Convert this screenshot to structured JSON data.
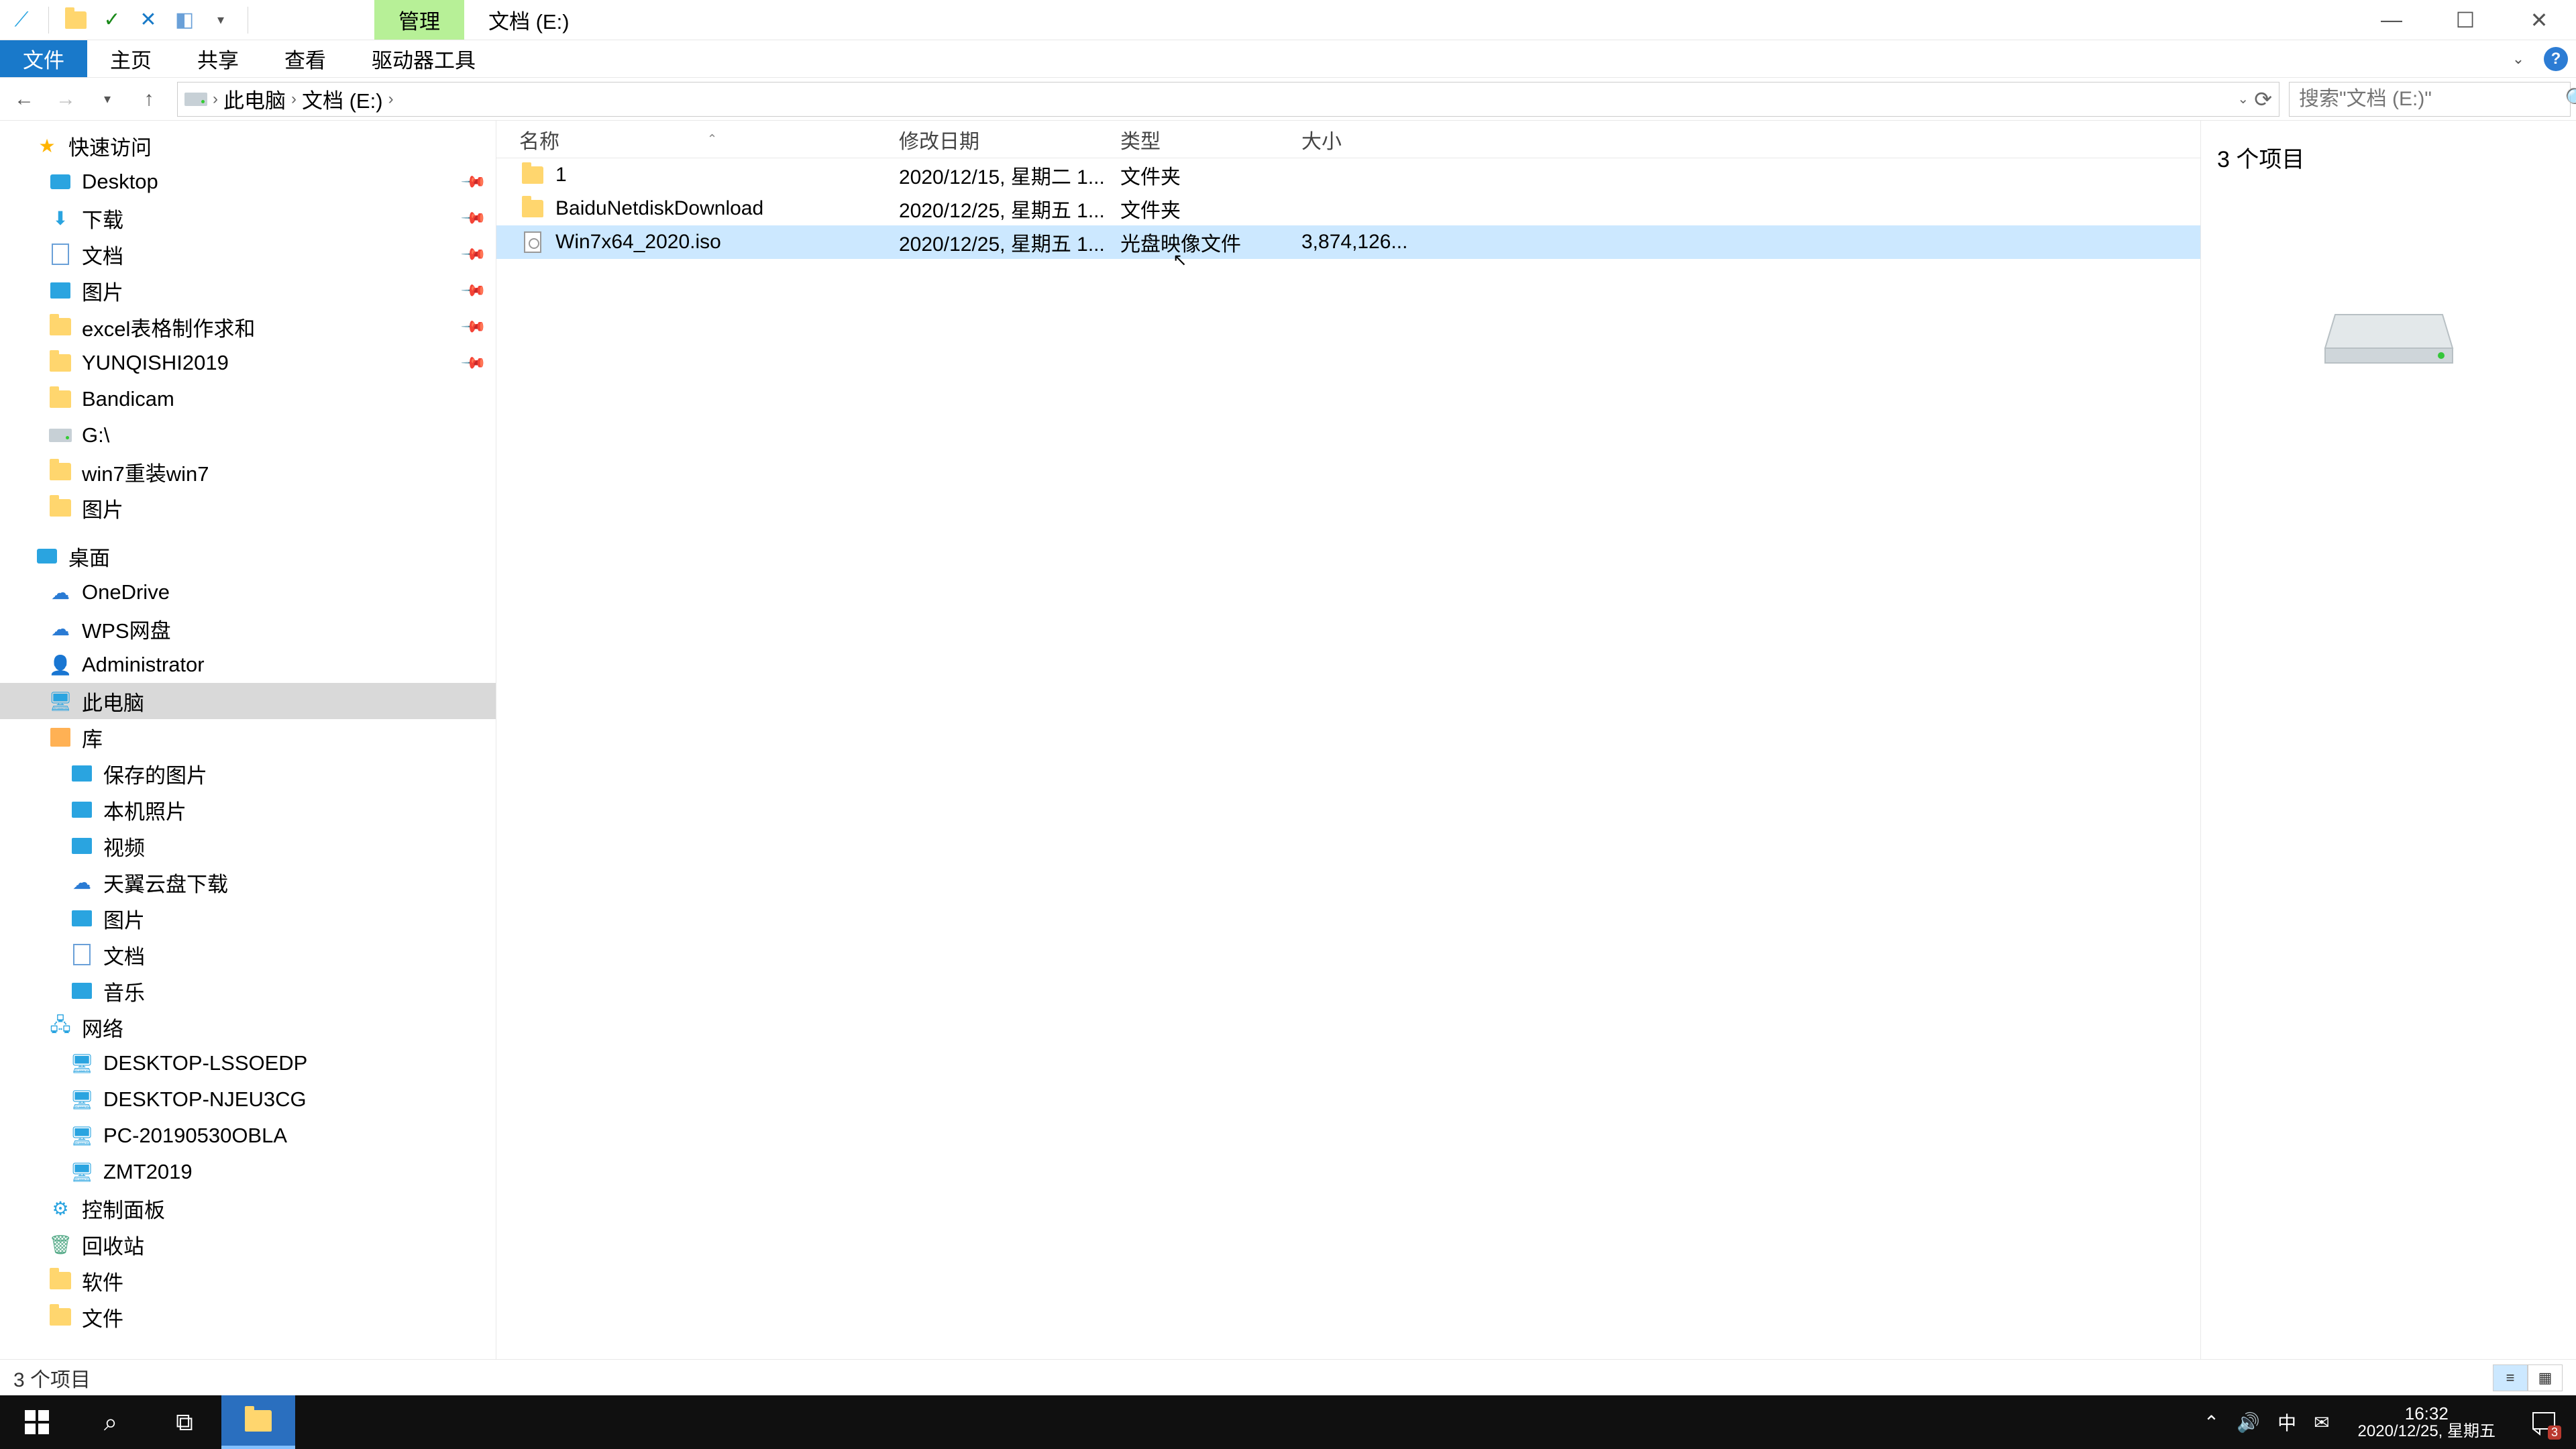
{
  "titlebar": {
    "qat": {
      "check": "✓",
      "cross": "✕"
    },
    "manage_tab": "管理",
    "window_title": "文档 (E:)"
  },
  "ribbon": {
    "file": "文件",
    "home": "主页",
    "share": "共享",
    "view": "查看",
    "drive_tools": "驱动器工具"
  },
  "nav": {
    "crumbs": {
      "this_pc": "此电脑",
      "drive": "文档 (E:)"
    },
    "search_placeholder": "搜索\"文档 (E:)\""
  },
  "columns": {
    "name": "名称",
    "date": "修改日期",
    "type": "类型",
    "size": "大小"
  },
  "files": [
    {
      "name": "1",
      "date": "2020/12/15, 星期二 1...",
      "type": "文件夹",
      "size": "",
      "icon": "folder"
    },
    {
      "name": "BaiduNetdiskDownload",
      "date": "2020/12/25, 星期五 1...",
      "type": "文件夹",
      "size": "",
      "icon": "folder"
    },
    {
      "name": "Win7x64_2020.iso",
      "date": "2020/12/25, 星期五 1...",
      "type": "光盘映像文件",
      "size": "3,874,126...",
      "icon": "iso",
      "selected": true
    }
  ],
  "tree": {
    "quick_access": "快速访问",
    "qa_items": [
      {
        "label": "Desktop",
        "icon": "desktop",
        "pin": true
      },
      {
        "label": "下载",
        "icon": "download",
        "pin": true
      },
      {
        "label": "文档",
        "icon": "doc",
        "pin": true
      },
      {
        "label": "图片",
        "icon": "pic",
        "pin": true
      },
      {
        "label": "excel表格制作求和",
        "icon": "folder",
        "pin": true
      },
      {
        "label": "YUNQISHI2019",
        "icon": "folder",
        "pin": true
      },
      {
        "label": "Bandicam",
        "icon": "folder"
      },
      {
        "label": "G:\\",
        "icon": "hdd"
      },
      {
        "label": "win7重装win7",
        "icon": "folder"
      },
      {
        "label": "图片",
        "icon": "folder"
      }
    ],
    "desktop": "桌面",
    "desktop_items": [
      {
        "label": "OneDrive",
        "icon": "cloud"
      },
      {
        "label": "WPS网盘",
        "icon": "cloud"
      },
      {
        "label": "Administrator",
        "icon": "user"
      },
      {
        "label": "此电脑",
        "icon": "pc",
        "selected": true
      },
      {
        "label": "库",
        "icon": "lib"
      }
    ],
    "lib_items": [
      {
        "label": "保存的图片",
        "icon": "pic"
      },
      {
        "label": "本机照片",
        "icon": "pic"
      },
      {
        "label": "视频",
        "icon": "pic"
      },
      {
        "label": "天翼云盘下载",
        "icon": "cloud"
      },
      {
        "label": "图片",
        "icon": "pic"
      },
      {
        "label": "文档",
        "icon": "doc"
      },
      {
        "label": "音乐",
        "icon": "pic"
      }
    ],
    "network": "网络",
    "network_items": [
      {
        "label": "DESKTOP-LSSOEDP",
        "icon": "pc"
      },
      {
        "label": "DESKTOP-NJEU3CG",
        "icon": "pc"
      },
      {
        "label": "PC-20190530OBLA",
        "icon": "pc"
      },
      {
        "label": "ZMT2019",
        "icon": "pc"
      }
    ],
    "other": [
      {
        "label": "控制面板",
        "icon": "panel"
      },
      {
        "label": "回收站",
        "icon": "recycle"
      },
      {
        "label": "软件",
        "icon": "folder"
      },
      {
        "label": "文件",
        "icon": "folder"
      }
    ]
  },
  "preview": {
    "item_count": "3 个项目"
  },
  "status": {
    "text": "3 个项目"
  },
  "taskbar": {
    "tray_ime": "中",
    "time": "16:32",
    "date": "2020/12/25, 星期五",
    "notif_count": "3"
  }
}
